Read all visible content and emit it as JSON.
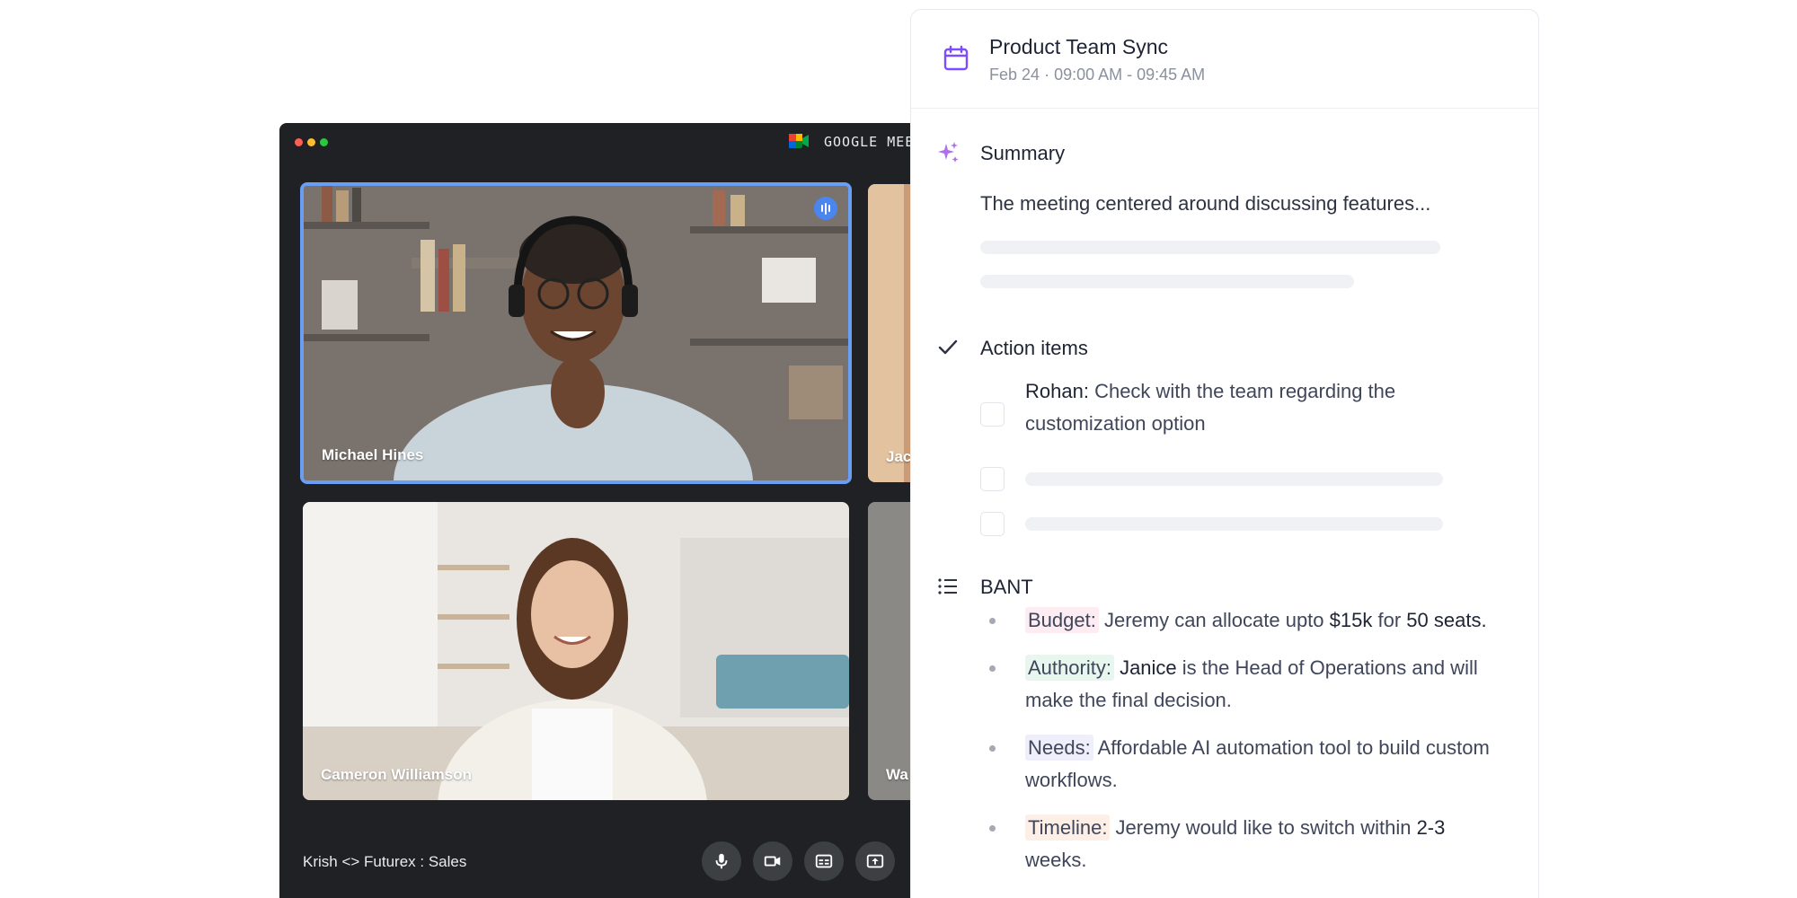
{
  "meet": {
    "app_title": "GOOGLE MEET",
    "meeting_name": "Krish <> Futurex : Sales",
    "participants": [
      {
        "name": "Michael Hines",
        "speaking": true
      },
      {
        "name": "Cameron Williamson",
        "speaking": false
      },
      {
        "name": "Jac",
        "speaking": false
      },
      {
        "name": "Wa",
        "speaking": false
      }
    ],
    "controls": [
      "mic-icon",
      "camera-icon",
      "captions-icon",
      "present-icon"
    ],
    "colors": {
      "window_bg": "#202124",
      "active_border": "#6a9ef4",
      "control_bg": "#3c4043"
    }
  },
  "panel": {
    "title": "Product Team Sync",
    "date": "Feb 24",
    "separator": "·",
    "time": "09:00 AM - 09:45 AM",
    "summary": {
      "title": "Summary",
      "text": "The meeting centered around discussing features..."
    },
    "action_items": {
      "title": "Action items",
      "first": {
        "owner": "Rohan:",
        "text": " Check with the team regarding the customization option"
      }
    },
    "bant": {
      "title": "BANT",
      "budget": {
        "label": "Budget:",
        "t1": " Jeremy can allocate upto ",
        "v1": "$15k",
        "t2": " for ",
        "v2": "50 seats."
      },
      "authority": {
        "label": "Authority:",
        "t0": " ",
        "v1": "Janice",
        "t1": " is the Head of Operations and will make the final decision."
      },
      "needs": {
        "label": "Needs:",
        "t1": " Affordable AI automation tool to build custom workflows."
      },
      "timeline": {
        "label": "Timeline:",
        "t1": " Jeremy would like to switch within ",
        "v1": "2-3",
        "t2": " weeks."
      }
    },
    "colors": {
      "accent": "#7c4dff",
      "budget_tag": "#fdecf1",
      "authority_tag": "#e7f7ef",
      "needs_tag": "#efeefb",
      "timeline_tag": "#fdefe6"
    }
  }
}
